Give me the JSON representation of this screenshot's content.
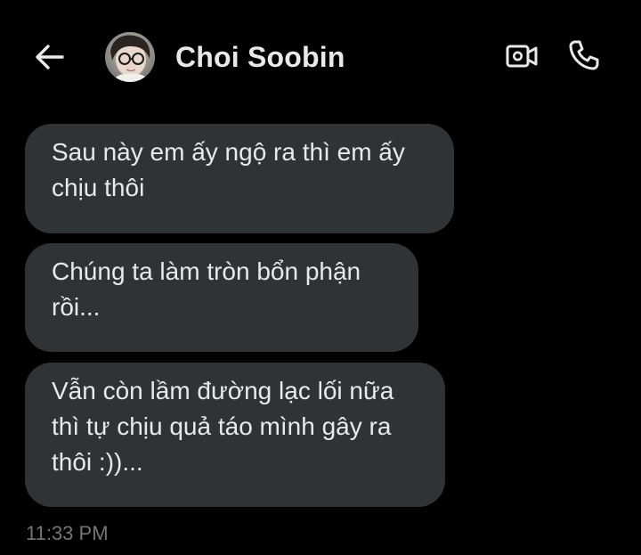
{
  "header": {
    "back_icon": "arrow-left-icon",
    "avatar_alt": "Choi Soobin avatar",
    "contact_name": "Choi Soobin",
    "video_icon": "video-camera-icon",
    "call_icon": "phone-icon"
  },
  "messages": [
    {
      "lines": [
        "Sau này em ấy ngộ ra thì em ấy",
        "chịu thôi"
      ]
    },
    {
      "lines": [
        "Chúng ta làm tròn bổn phận",
        "rồi..."
      ]
    },
    {
      "lines": [
        "Vẫn còn lầm đường lạc lối nữa",
        "thì tự chịu quả táo mình gây ra",
        "thôi :))..."
      ]
    }
  ],
  "timestamp": "11:33 PM",
  "colors": {
    "background": "#000000",
    "bubble": "#2f3336",
    "text": "#e7e9ea",
    "muted": "#71767b"
  }
}
